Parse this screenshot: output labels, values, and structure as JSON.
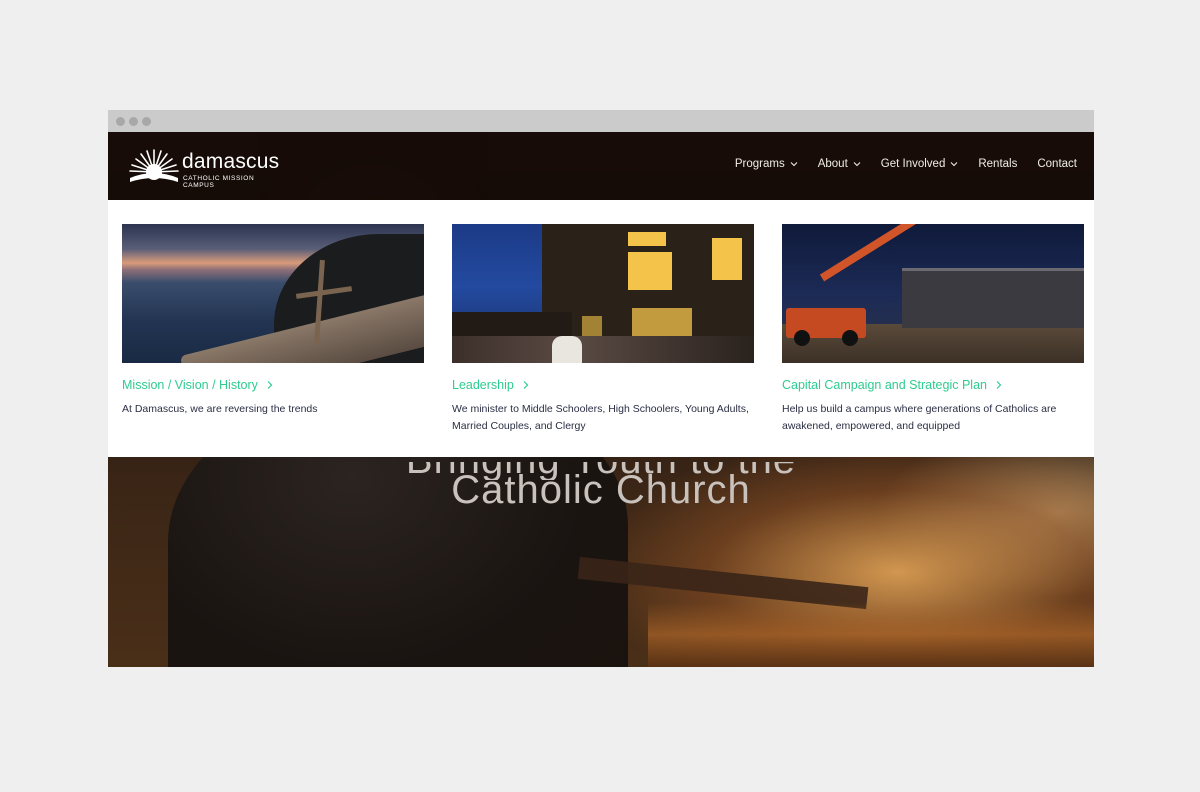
{
  "brand": {
    "name": "damascus",
    "tagline": "CATHOLIC MISSION CAMPUS"
  },
  "nav": {
    "items": [
      {
        "label": "Programs"
      },
      {
        "label": "About"
      },
      {
        "label": "Get Involved"
      },
      {
        "label": "Rentals"
      },
      {
        "label": "Contact"
      }
    ]
  },
  "dropdown": {
    "cards": [
      {
        "title": "Mission / Vision / History",
        "description": "At Damascus, we are reversing the trends"
      },
      {
        "title": "Leadership",
        "description": "We minister to Middle Schoolers, High Schoolers, Young Adults, Married Couples, and Clergy"
      },
      {
        "title": "Capital Campaign and Strategic Plan",
        "description": "Help us build a campus where generations of Catholics are awakened, empowered, and equipped"
      }
    ]
  },
  "hero": {
    "title_partial": "Bringing Youth to the",
    "title": "Catholic Church"
  },
  "colors": {
    "accent": "#2ecc8f",
    "nav_bg": "#140a06",
    "text_dark": "#2b2f44"
  }
}
